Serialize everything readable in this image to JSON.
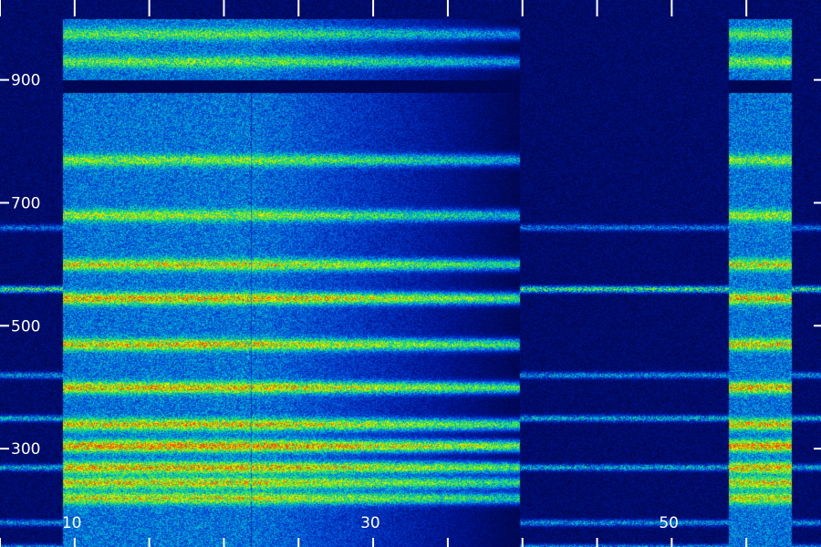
{
  "chart_data": {
    "type": "heatmap",
    "title": "",
    "xlabel": "",
    "ylabel": "",
    "xlim": [
      5,
      60
    ],
    "ylim": [
      140,
      1030
    ],
    "x_ticks": [
      {
        "value": 10,
        "label": "10"
      },
      {
        "value": 30,
        "label": "30"
      },
      {
        "value": 50,
        "label": "50"
      }
    ],
    "x_minor_ticks": [
      5,
      15,
      20,
      25,
      35,
      40,
      45,
      55
    ],
    "y_ticks": [
      {
        "value": 900,
        "label": "900"
      },
      {
        "value": 700,
        "label": "700"
      },
      {
        "value": 500,
        "label": "500"
      },
      {
        "value": 300,
        "label": "300"
      }
    ],
    "colormap": [
      "#000030",
      "#0018a0",
      "#0058e0",
      "#00c0d0",
      "#20e060",
      "#a0f000",
      "#f8f000",
      "#ff4000"
    ],
    "segments": [
      {
        "x_start": 9.2,
        "x_end": 39.8,
        "y_top": 1000,
        "fade_x_from": 22,
        "fade_strength": 0.3
      },
      {
        "x_start": 53.8,
        "x_end": 58.0,
        "y_top": 1000,
        "fade_x_from": 0,
        "fade_strength": 0
      }
    ],
    "bands": [
      {
        "y": 305,
        "intensity": 0.95
      },
      {
        "y": 270,
        "intensity": 0.85
      },
      {
        "y": 245,
        "intensity": 0.75
      },
      {
        "y": 220,
        "intensity": 0.7
      },
      {
        "y": 340,
        "intensity": 0.8
      },
      {
        "y": 400,
        "intensity": 0.82
      },
      {
        "y": 470,
        "intensity": 0.78
      },
      {
        "y": 545,
        "intensity": 0.85
      },
      {
        "y": 600,
        "intensity": 0.72
      },
      {
        "y": 680,
        "intensity": 0.6
      },
      {
        "y": 770,
        "intensity": 0.55
      },
      {
        "y": 930,
        "intensity": 0.5
      },
      {
        "y": 975,
        "intensity": 0.45
      }
    ],
    "background_lines": [
      {
        "y": 270,
        "intensity": 0.35
      },
      {
        "y": 350,
        "intensity": 0.35
      },
      {
        "y": 420,
        "intensity": 0.3
      },
      {
        "y": 560,
        "intensity": 0.5
      },
      {
        "y": 660,
        "intensity": 0.25
      },
      {
        "y": 180,
        "intensity": 0.3
      },
      {
        "y": 140,
        "intensity": 0.3
      }
    ],
    "vertical_lines": [
      {
        "x": 21.8,
        "intensity": 0.4
      }
    ],
    "grid": false
  }
}
